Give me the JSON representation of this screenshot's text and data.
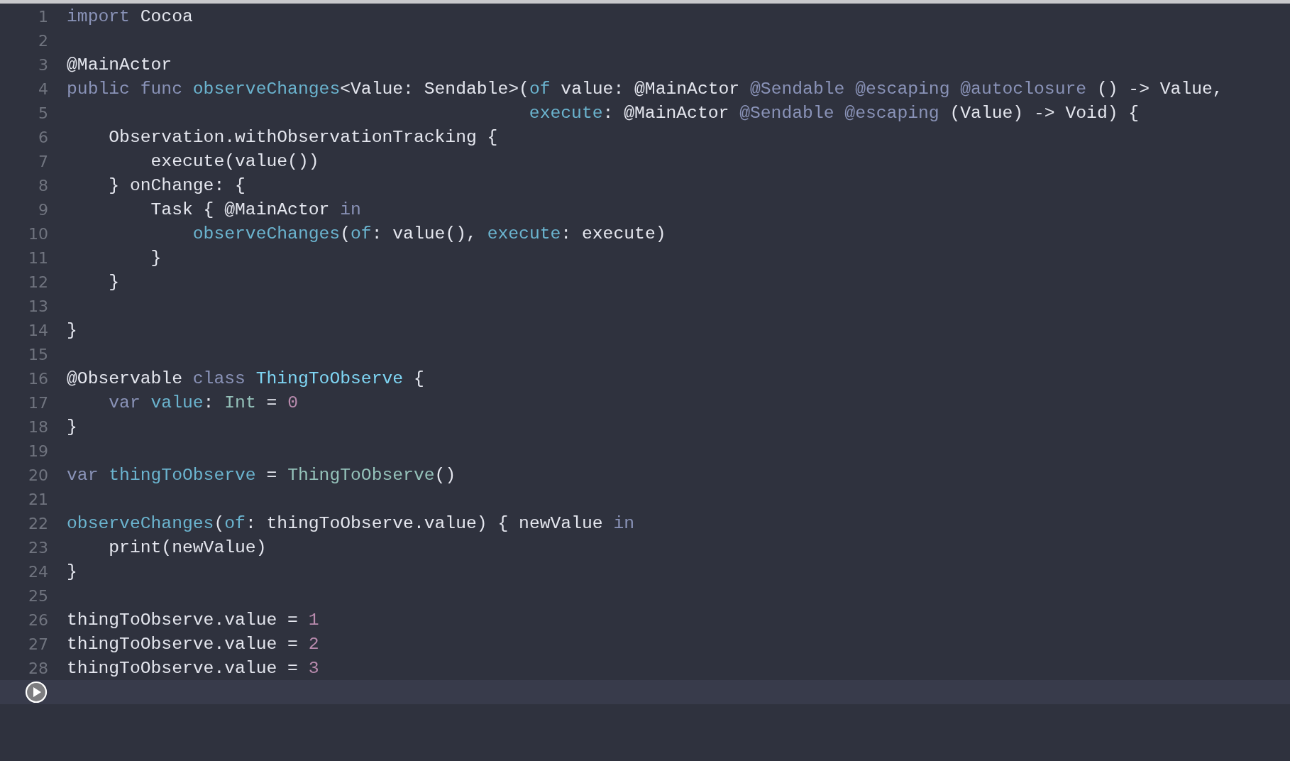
{
  "editor": {
    "lines": [
      {
        "number": "1",
        "tokens": [
          {
            "text": "import",
            "kind": "keyword"
          },
          {
            "text": " Cocoa",
            "kind": "plain"
          }
        ]
      },
      {
        "number": "2"
      },
      {
        "number": "3",
        "tokens": [
          {
            "text": "@MainActor",
            "kind": "plain"
          }
        ]
      },
      {
        "number": "4",
        "tokens": [
          {
            "text": "public",
            "kind": "keyword"
          },
          {
            "text": " func",
            "kind": "keyword"
          },
          {
            "text": " observeChanges",
            "kind": "function"
          },
          {
            "text": "<Value: Sendable>(",
            "kind": "plain"
          },
          {
            "text": "of",
            "kind": "function"
          },
          {
            "text": " value: @MainActor ",
            "kind": "plain"
          },
          {
            "text": "@Sendable @escaping @autoclosure",
            "kind": "keyword"
          },
          {
            "text": " () -> Value,",
            "kind": "plain"
          }
        ]
      },
      {
        "number": "5",
        "tokens": [
          {
            "text": "                                            execute",
            "kind": "function"
          },
          {
            "text": ": @MainActor ",
            "kind": "plain"
          },
          {
            "text": "@Sendable @escaping",
            "kind": "keyword"
          },
          {
            "text": " (Value) -> Void) {",
            "kind": "plain"
          }
        ]
      },
      {
        "number": "6",
        "tokens": [
          {
            "text": "    Observation.withObservationTracking {",
            "kind": "plain"
          }
        ]
      },
      {
        "number": "7",
        "tokens": [
          {
            "text": "        execute(value())",
            "kind": "plain"
          }
        ]
      },
      {
        "number": "8",
        "tokens": [
          {
            "text": "    } onChange: {",
            "kind": "plain"
          }
        ]
      },
      {
        "number": "9",
        "tokens": [
          {
            "text": "        Task { @MainActor ",
            "kind": "plain"
          },
          {
            "text": "in",
            "kind": "keyword"
          }
        ]
      },
      {
        "number": "10",
        "tokens": [
          {
            "text": "            observeChanges",
            "kind": "function"
          },
          {
            "text": "(",
            "kind": "plain"
          },
          {
            "text": "of",
            "kind": "function"
          },
          {
            "text": ": value(), ",
            "kind": "plain"
          },
          {
            "text": "execute",
            "kind": "function"
          },
          {
            "text": ": execute)",
            "kind": "plain"
          }
        ]
      },
      {
        "number": "11",
        "tokens": [
          {
            "text": "        }",
            "kind": "plain"
          }
        ]
      },
      {
        "number": "12",
        "tokens": [
          {
            "text": "    }",
            "kind": "plain"
          }
        ]
      },
      {
        "number": "13"
      },
      {
        "number": "14",
        "tokens": [
          {
            "text": "}",
            "kind": "plain"
          }
        ]
      },
      {
        "number": "15"
      },
      {
        "number": "16",
        "tokens": [
          {
            "text": "@Observable ",
            "kind": "plain"
          },
          {
            "text": "class",
            "kind": "keyword"
          },
          {
            "text": " ThingToObserve",
            "kind": "classname"
          },
          {
            "text": " {",
            "kind": "plain"
          }
        ]
      },
      {
        "number": "17",
        "tokens": [
          {
            "text": "    var",
            "kind": "keyword"
          },
          {
            "text": " value",
            "kind": "function"
          },
          {
            "text": ": ",
            "kind": "plain"
          },
          {
            "text": "Int",
            "kind": "type"
          },
          {
            "text": " = ",
            "kind": "plain"
          },
          {
            "text": "0",
            "kind": "number"
          }
        ]
      },
      {
        "number": "18",
        "tokens": [
          {
            "text": "}",
            "kind": "plain"
          }
        ]
      },
      {
        "number": "19"
      },
      {
        "number": "20",
        "tokens": [
          {
            "text": "var",
            "kind": "keyword"
          },
          {
            "text": " thingToObserve",
            "kind": "function"
          },
          {
            "text": " = ",
            "kind": "plain"
          },
          {
            "text": "ThingToObserve",
            "kind": "type"
          },
          {
            "text": "()",
            "kind": "plain"
          }
        ]
      },
      {
        "number": "21"
      },
      {
        "number": "22",
        "tokens": [
          {
            "text": "observeChanges",
            "kind": "function"
          },
          {
            "text": "(",
            "kind": "plain"
          },
          {
            "text": "of",
            "kind": "function"
          },
          {
            "text": ": thingToObserve.value) { newValue ",
            "kind": "plain"
          },
          {
            "text": "in",
            "kind": "keyword"
          }
        ]
      },
      {
        "number": "23",
        "tokens": [
          {
            "text": "    print(newValue)",
            "kind": "plain"
          }
        ]
      },
      {
        "number": "24",
        "tokens": [
          {
            "text": "}",
            "kind": "plain"
          }
        ]
      },
      {
        "number": "25"
      },
      {
        "number": "26",
        "tokens": [
          {
            "text": "thingToObserve.value = ",
            "kind": "plain"
          },
          {
            "text": "1",
            "kind": "number"
          }
        ]
      },
      {
        "number": "27",
        "tokens": [
          {
            "text": "thingToObserve.value = ",
            "kind": "plain"
          },
          {
            "text": "2",
            "kind": "number"
          }
        ]
      },
      {
        "number": "28",
        "tokens": [
          {
            "text": "thingToObserve.value = ",
            "kind": "plain"
          },
          {
            "text": "3",
            "kind": "number"
          }
        ]
      }
    ]
  }
}
